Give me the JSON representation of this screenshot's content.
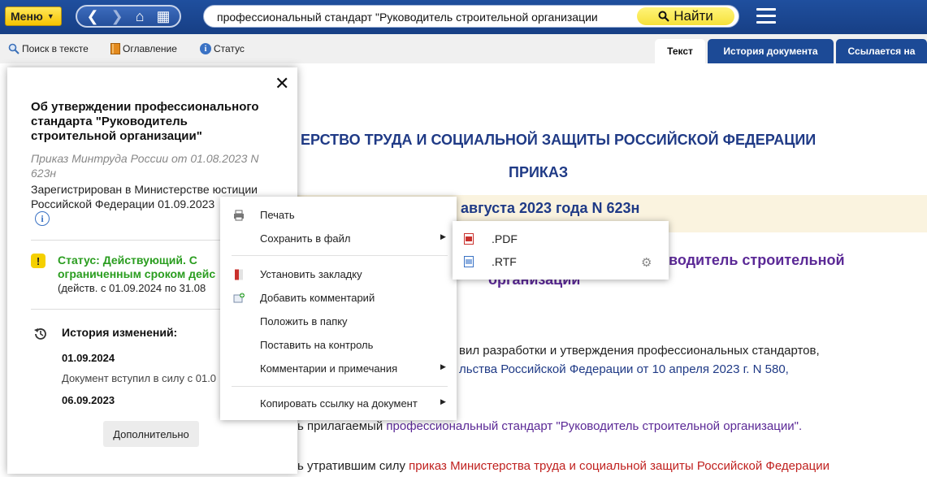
{
  "topbar": {
    "menu_label": "Меню",
    "search_value": "профессиональный стандарт \"Руководитель строительной организации",
    "find_label": "Найти"
  },
  "toolbar": {
    "search_in_text": "Поиск в тексте",
    "contents": "Оглавление",
    "status": "Статус"
  },
  "tabs": [
    {
      "label": "Текст"
    },
    {
      "label": "История документа"
    },
    {
      "label": "Ссылается на"
    }
  ],
  "document": {
    "ministry": "ЕРСТВО ТРУДА И СОЦИАЛЬНОЙ ЗАЩИТЫ РОССИЙСКОЙ ФЕДЕРАЦИИ",
    "order": "ПРИКАЗ",
    "date": "августа 2023 года N 623н",
    "title_line1": "водитель строительной",
    "title_line2": "организации",
    "para1": "вил разработки и утверждения профессиональных стандартов,",
    "para2": "льства Российской Федерации от 10 апреля 2023 г. N 580,",
    "para3_prefix": "ь прилагаемый ",
    "para3_link": "профессиональный стандарт \"Руководитель строительной организации\".",
    "para4_prefix": "ь утратившим силу ",
    "para4_link": "приказ Министерства труда и социальной защиты Российской Федерации"
  },
  "status_panel": {
    "title": "Об утверждении профессионального стандарта \"Руководитель строительной организации\"",
    "meta": "Приказ Минтруда России от 01.08.2023 N 623н",
    "registration": "Зарегистрирован в Министерстве юстиции Российской Федерации 01.09.2023",
    "status_line1": "Статус: Действующий. С",
    "status_line2": "ограниченным сроком дейс",
    "status_dates": "(действ. с 01.09.2024 по 31.08",
    "history_title": "История изменений:",
    "history": [
      {
        "date": "01.09.2024",
        "desc": "Документ вступил в силу с 01.0"
      },
      {
        "date": "06.09.2023"
      }
    ],
    "more_button": "Дополнительно"
  },
  "context_menu": {
    "print": "Печать",
    "save_to_file": "Сохранить в файл",
    "bookmark": "Установить закладку",
    "add_comment": "Добавить комментарий",
    "to_folder": "Положить в папку",
    "to_control": "Поставить на контроль",
    "comments_notes": "Комментарии и примечания",
    "copy_link": "Копировать ссылку на документ"
  },
  "save_submenu": {
    "pdf": ".PDF",
    "rtf": ".RTF"
  },
  "colors": {
    "topbar": "#1c4a96",
    "accent_yellow": "#f6c300",
    "status_green": "#2a9d1f",
    "link_purple": "#5b2996",
    "link_red": "#c0211f",
    "heading_blue": "#1f3a86"
  }
}
